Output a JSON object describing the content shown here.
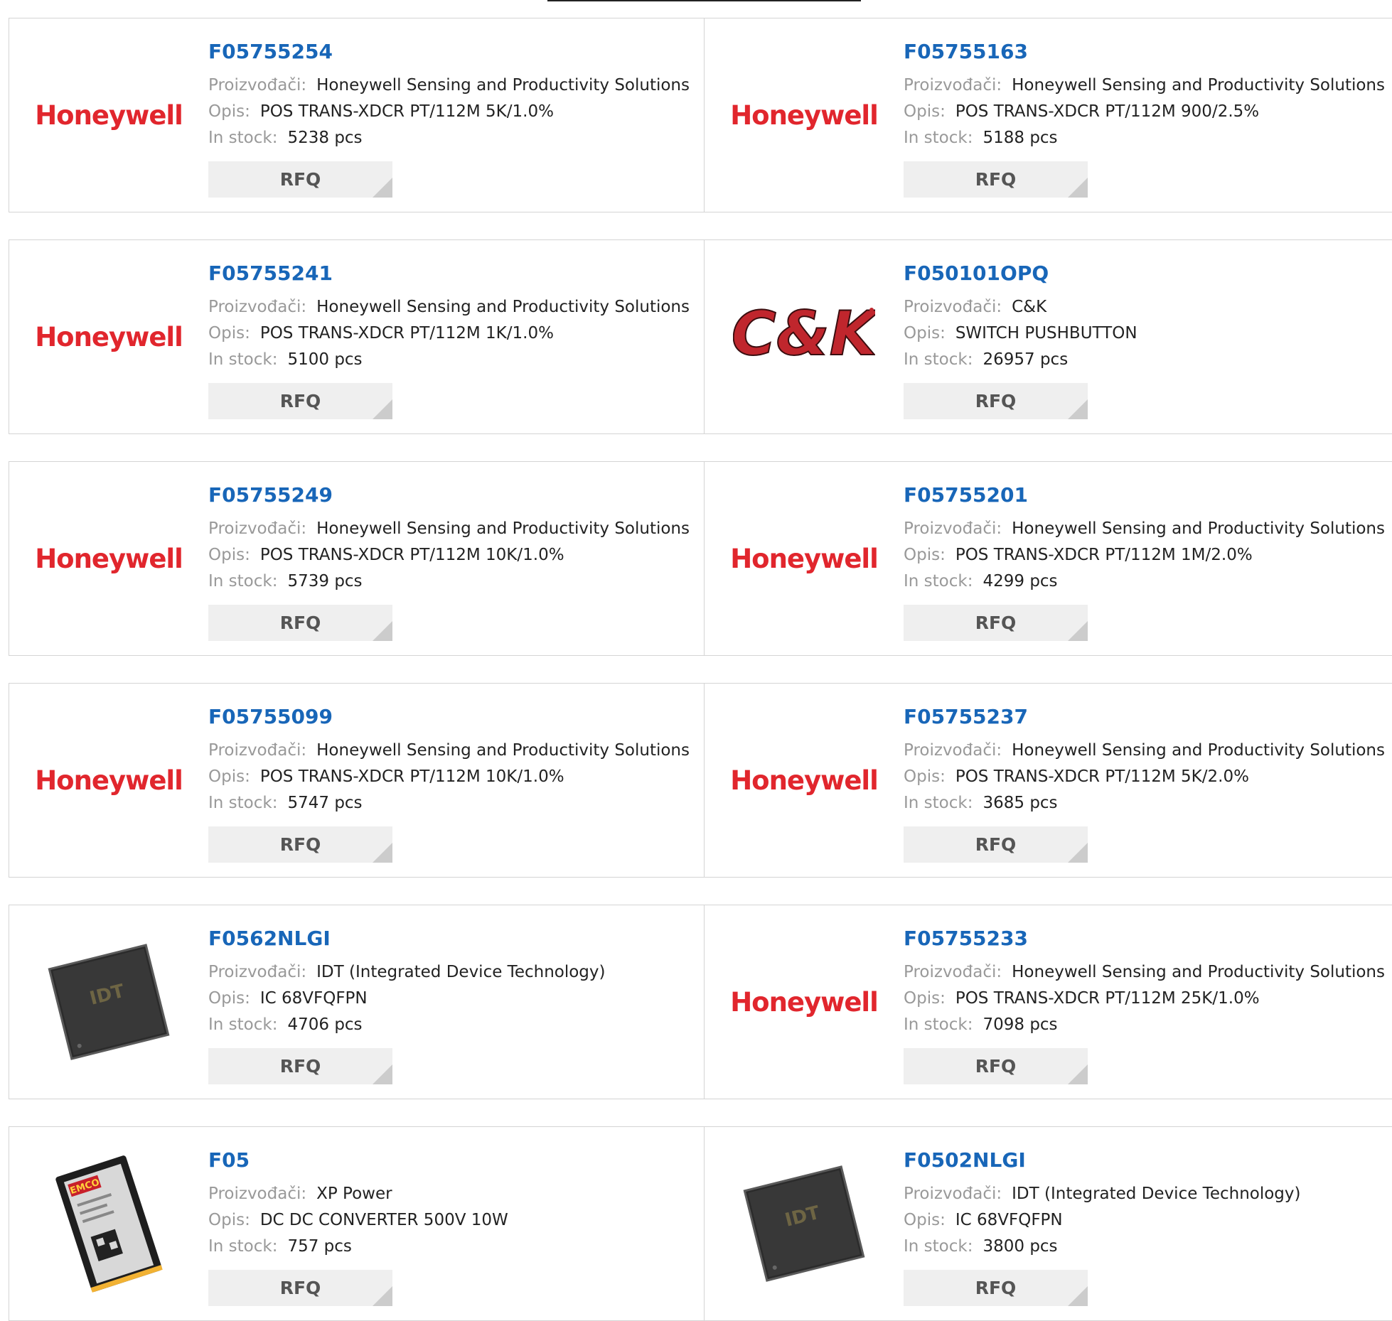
{
  "labels": {
    "manufacturer": "Proizvođači:",
    "description": "Opis:",
    "stock": "In stock:",
    "rfq": "RFQ"
  },
  "colors": {
    "part_link": "#1866b8",
    "honeywell_red": "#e1262d",
    "rfq_bg": "#efefef"
  },
  "products": [
    {
      "pn": "F05755254",
      "logo": "honeywell-logo",
      "logo_text": "Honeywell",
      "manufacturer": "Honeywell Sensing and Productivity Solutions",
      "description": "POS TRANS-XDCR PT/112M 5K/1.0%",
      "stock": "5238 pcs"
    },
    {
      "pn": "F05755163",
      "logo": "honeywell-logo",
      "logo_text": "Honeywell",
      "manufacturer": "Honeywell Sensing and Productivity Solutions",
      "description": "POS TRANS-XDCR PT/112M 900/2.5%",
      "stock": "5188 pcs"
    },
    {
      "pn": "F05755241",
      "logo": "honeywell-logo",
      "logo_text": "Honeywell",
      "manufacturer": "Honeywell Sensing and Productivity Solutions",
      "description": "POS TRANS-XDCR PT/112M 1K/1.0%",
      "stock": "5100 pcs"
    },
    {
      "pn": "F050101OPQ",
      "logo": "ck-logo",
      "logo_text": "C&K",
      "manufacturer": "C&K",
      "description": "SWITCH PUSHBUTTON",
      "stock": "26957 pcs"
    },
    {
      "pn": "F05755249",
      "logo": "honeywell-logo",
      "logo_text": "Honeywell",
      "manufacturer": "Honeywell Sensing and Productivity Solutions",
      "description": "POS TRANS-XDCR PT/112M 10K/1.0%",
      "stock": "5739 pcs"
    },
    {
      "pn": "F05755201",
      "logo": "honeywell-logo",
      "logo_text": "Honeywell",
      "manufacturer": "Honeywell Sensing and Productivity Solutions",
      "description": "POS TRANS-XDCR PT/112M 1M/2.0%",
      "stock": "4299 pcs"
    },
    {
      "pn": "F05755099",
      "logo": "honeywell-logo",
      "logo_text": "Honeywell",
      "manufacturer": "Honeywell Sensing and Productivity Solutions",
      "description": "POS TRANS-XDCR PT/112M 10K/1.0%",
      "stock": "5747 pcs"
    },
    {
      "pn": "F05755237",
      "logo": "honeywell-logo",
      "logo_text": "Honeywell",
      "manufacturer": "Honeywell Sensing and Productivity Solutions",
      "description": "POS TRANS-XDCR PT/112M 5K/2.0%",
      "stock": "3685 pcs"
    },
    {
      "pn": "F0562NLGI",
      "logo": "idt-chip-image",
      "logo_text": "IDT",
      "manufacturer": "IDT (Integrated Device Technology)",
      "description": "IC 68VFQFPN",
      "stock": "4706 pcs"
    },
    {
      "pn": "F05755233",
      "logo": "honeywell-logo",
      "logo_text": "Honeywell",
      "manufacturer": "Honeywell Sensing and Productivity Solutions",
      "description": "POS TRANS-XDCR PT/112M 25K/1.0%",
      "stock": "7098 pcs"
    },
    {
      "pn": "F05",
      "logo": "emco-converter-image",
      "logo_text": "EMCO",
      "manufacturer": "XP Power",
      "description": "DC DC CONVERTER 500V 10W",
      "stock": "757 pcs"
    },
    {
      "pn": "F0502NLGI",
      "logo": "idt-chip-image",
      "logo_text": "IDT",
      "manufacturer": "IDT (Integrated Device Technology)",
      "description": "IC 68VFQFPN",
      "stock": "3800 pcs"
    }
  ]
}
